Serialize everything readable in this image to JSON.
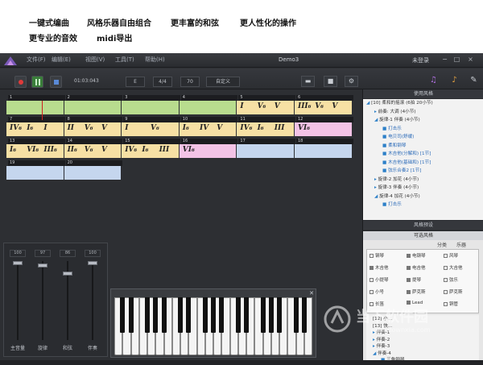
{
  "features": {
    "f1": "一键式编曲",
    "f2": "风格乐器自由组合",
    "f3": "更丰富的和弦",
    "f4": "更人性化的操作",
    "f5": "更专业的音效",
    "f6": "midi导出"
  },
  "titlebar": {
    "menus": [
      "文件(F)",
      "编辑(E)",
      "视图(V)",
      "工具(T)",
      "帮助(H)"
    ],
    "doc_title": "Demo3",
    "login": "未登录",
    "min": "−",
    "max": "□",
    "close": "×"
  },
  "toolbar": {
    "time": "01:03:043",
    "key": "E",
    "meter": "4/4",
    "tempo": "70",
    "custom": "自定义"
  },
  "measures": [
    {
      "num": "1",
      "color": "green",
      "chords": []
    },
    {
      "num": "2",
      "color": "green",
      "chords": []
    },
    {
      "num": "3",
      "color": "green",
      "chords": []
    },
    {
      "num": "4",
      "color": "green",
      "chords": []
    },
    {
      "num": "5",
      "color": "yellow",
      "chords": [
        "I",
        "V₆",
        "V"
      ]
    },
    {
      "num": "6",
      "color": "yellow",
      "chords": [
        "III₆",
        "V₆",
        "V"
      ]
    },
    {
      "num": "7",
      "color": "yellow",
      "chords": [
        "IV₆",
        "I₆",
        "I"
      ]
    },
    {
      "num": "8",
      "color": "yellow",
      "chords": [
        "II",
        "V₆",
        "V"
      ]
    },
    {
      "num": "9",
      "color": "yellow",
      "chords": [
        "I",
        "V₆"
      ]
    },
    {
      "num": "10",
      "color": "yellow",
      "chords": [
        "I₆",
        "IV",
        "V"
      ]
    },
    {
      "num": "11",
      "color": "yellow",
      "chords": [
        "IV₆",
        "I₆",
        "III"
      ]
    },
    {
      "num": "12",
      "color": "pink",
      "chords": [
        "VI₆"
      ]
    },
    {
      "num": "13",
      "color": "yellow",
      "chords": [
        "I₆",
        "VI₆",
        "III₆"
      ]
    },
    {
      "num": "14",
      "color": "yellow",
      "chords": [
        "II₆",
        "V₆",
        "V"
      ]
    },
    {
      "num": "15",
      "color": "yellow",
      "chords": [
        "IV₆",
        "I₆",
        "III"
      ]
    },
    {
      "num": "16",
      "color": "pink",
      "chords": [
        "VI₆"
      ]
    },
    {
      "num": "17",
      "color": "blue",
      "chords": []
    },
    {
      "num": "18",
      "color": "blue",
      "chords": []
    },
    {
      "num": "19",
      "color": "blue",
      "chords": []
    },
    {
      "num": "20",
      "color": "blue",
      "chords": []
    }
  ],
  "mixer": [
    {
      "name": "主音量",
      "value": "100",
      "level": 100
    },
    {
      "name": "旋律",
      "value": "97",
      "level": 97
    },
    {
      "name": "和弦",
      "value": "86",
      "level": 86
    },
    {
      "name": "伴奏",
      "value": "100",
      "level": 100
    }
  ],
  "sidebar": {
    "head1": "使用风格",
    "tree": [
      {
        "indent": 0,
        "arrow": "◢",
        "text": "[10] 柔和的摇滚 (6拍 20小节)"
      },
      {
        "indent": 1,
        "arrow": "▸",
        "text": "前奏: 大调 (4小节)"
      },
      {
        "indent": 1,
        "arrow": "◢",
        "text": "旋律-1 伴奏 (4小节)"
      },
      {
        "indent": 2,
        "arrow": "■",
        "text": "打击乐"
      },
      {
        "indent": 2,
        "arrow": "■",
        "text": "电贝司(舒缓)"
      },
      {
        "indent": 2,
        "arrow": "■",
        "text": "柔和钢琴"
      },
      {
        "indent": 2,
        "arrow": "■",
        "text": "木吉他(分解和) [1节]"
      },
      {
        "indent": 2,
        "arrow": "■",
        "text": "木吉他(基础和) [1节]"
      },
      {
        "indent": 2,
        "arrow": "■",
        "text": "弦乐合奏2 [1节]"
      },
      {
        "indent": 1,
        "arrow": "▸",
        "text": "旋律-2 加花 (4小节)"
      },
      {
        "indent": 1,
        "arrow": "▸",
        "text": "旋律-3 伴奏 (4小节)"
      },
      {
        "indent": 1,
        "arrow": "◢",
        "text": "旋律-4 加花 (4小节)"
      },
      {
        "indent": 2,
        "arrow": "■",
        "text": "打击乐"
      }
    ],
    "head2": "风格预设",
    "optpanel": {
      "sub": "可选风格",
      "tab1": "分类",
      "tab2": "乐器",
      "options": [
        "钢琴",
        "电钢琴",
        "风琴",
        "木吉他",
        "电吉他",
        "大吉他",
        "小提琴",
        "提琴",
        "弦乐",
        "小号",
        "萨克斯",
        "萨克斯",
        "长笛",
        "Lead",
        "铜管"
      ],
      "filled": [
        1,
        3,
        4,
        7,
        10,
        13
      ],
      "tree2": [
        {
          "arrow": "",
          "text": "[12] 小..."
        },
        {
          "arrow": "",
          "text": "[13] 快..."
        },
        {
          "arrow": "▸",
          "text": "伴奏-1"
        },
        {
          "arrow": "▸",
          "text": "伴奏-2"
        },
        {
          "arrow": "▸",
          "text": "伴奏-3"
        },
        {
          "arrow": "◢",
          "text": "伴奏-4"
        },
        {
          "arrow": "■",
          "text": "三角钢琴"
        }
      ]
    }
  },
  "watermark": {
    "text": "当下软件园",
    "url": "www.downxia.com"
  },
  "colors": {
    "green": "#b8dc8e",
    "yellow": "#f6e0a4",
    "pink": "#f3c3e6",
    "blue": "#c5d6ee"
  }
}
